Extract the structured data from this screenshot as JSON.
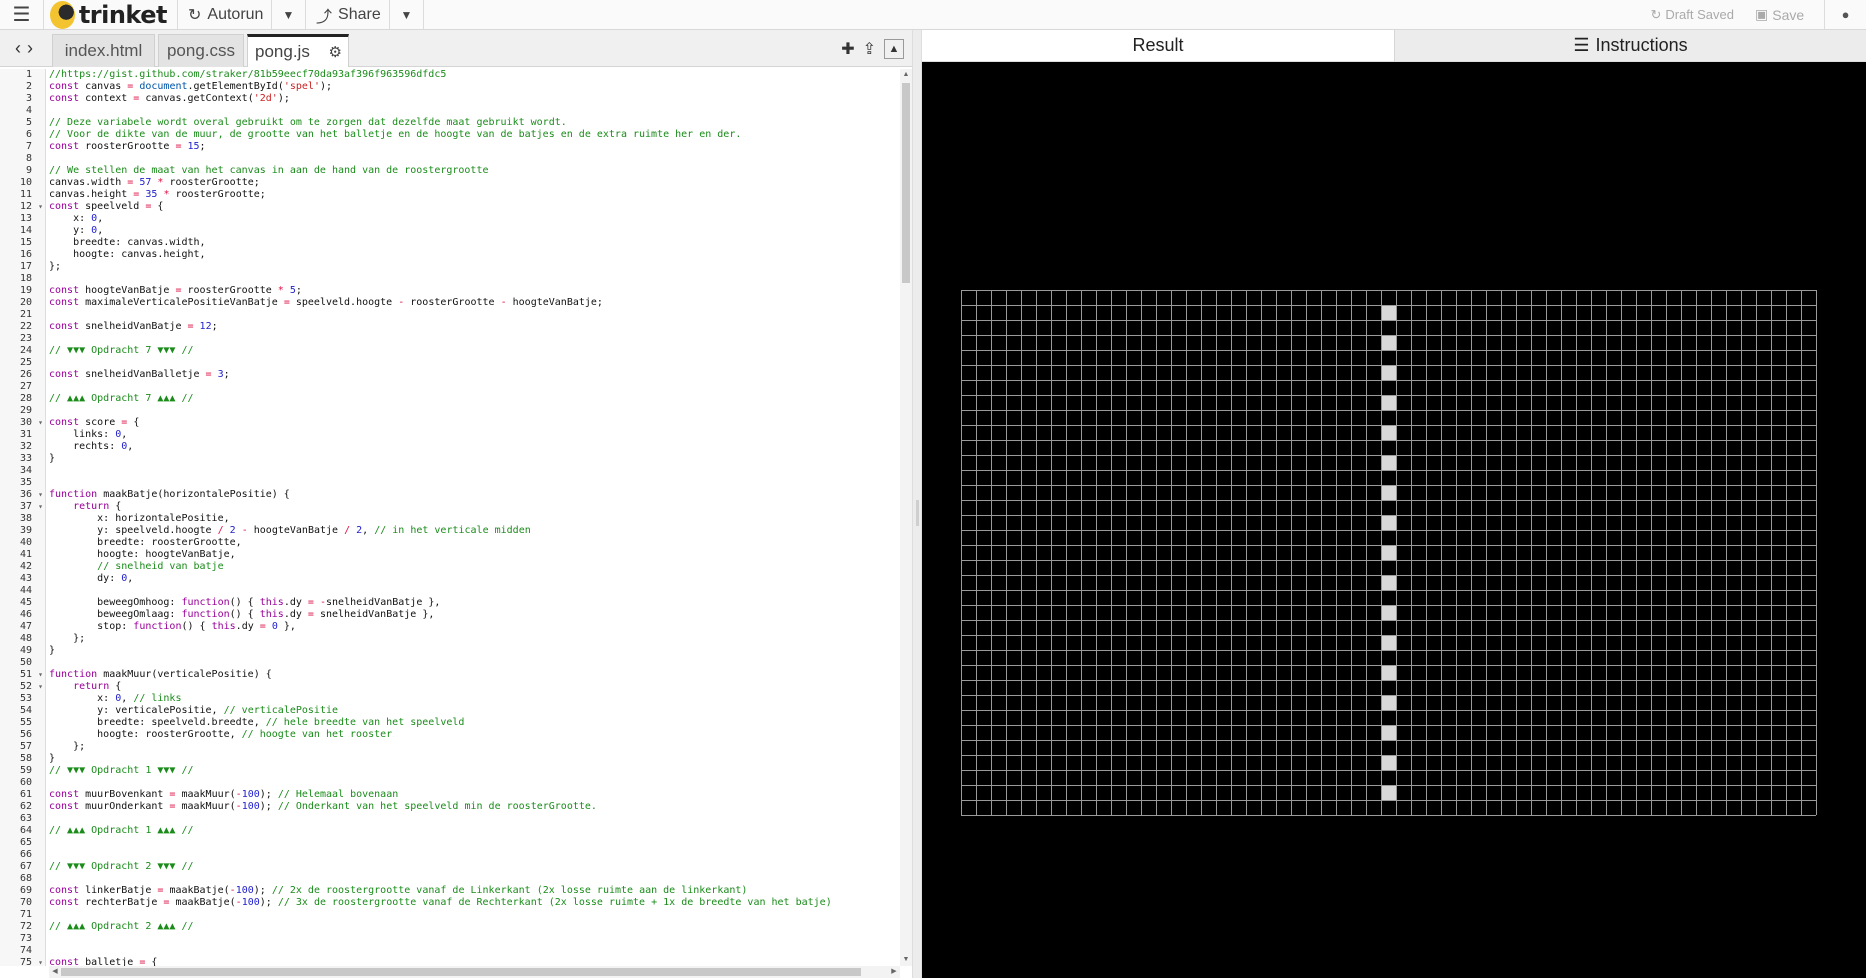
{
  "topbar": {
    "brand": "trinket",
    "autorun_label": "Autorun",
    "share_label": "Share",
    "draft_status": "Draft Saved",
    "save_label": "Save"
  },
  "editor": {
    "tabs": [
      {
        "label": "index.html",
        "active": false
      },
      {
        "label": "pong.css",
        "active": false
      },
      {
        "label": "pong.js",
        "active": true
      }
    ],
    "folds": [
      12,
      30,
      36,
      37,
      51,
      52,
      75
    ],
    "code": [
      "//https://gist.github.com/straker/81b59eecf70da93af396f963596dfdc5",
      "const canvas = document.getElementById('spel');",
      "const context = canvas.getContext('2d');",
      "",
      "// Deze variabele wordt overal gebruikt om te zorgen dat dezelfde maat gebruikt wordt.",
      "// Voor de dikte van de muur, de grootte van het balletje en de hoogte van de batjes en de extra ruimte her en der.",
      "const roosterGrootte = 15;",
      "",
      "// We stellen de maat van het canvas in aan de hand van de roostergrootte",
      "canvas.width = 57 * roosterGrootte;",
      "canvas.height = 35 * roosterGrootte;",
      "const speelveld = {",
      "    x: 0,",
      "    y: 0,",
      "    breedte: canvas.width,",
      "    hoogte: canvas.height,",
      "};",
      "",
      "const hoogteVanBatje = roosterGrootte * 5;",
      "const maximaleVerticalePositieVanBatje = speelveld.hoogte - roosterGrootte - hoogteVanBatje;",
      "",
      "const snelheidVanBatje = 12;",
      "",
      "// ▼▼▼ Opdracht 7 ▼▼▼ //",
      "",
      "const snelheidVanBalletje = 3;",
      "",
      "// ▲▲▲ Opdracht 7 ▲▲▲ //",
      "",
      "const score = {",
      "    links: 0,",
      "    rechts: 0,",
      "}",
      "",
      "",
      "function maakBatje(horizontalePositie) {",
      "    return {",
      "        x: horizontalePositie,",
      "        y: speelveld.hoogte / 2 - hoogteVanBatje / 2, // in het verticale midden",
      "        breedte: roosterGrootte,",
      "        hoogte: hoogteVanBatje,",
      "        // snelheid van batje",
      "        dy: 0,",
      "",
      "        beweegOmhoog: function() { this.dy = -snelheidVanBatje },",
      "        beweegOmlaag: function() { this.dy = snelheidVanBatje },",
      "        stop: function() { this.dy = 0 },",
      "    };",
      "}",
      "",
      "function maakMuur(verticalePositie) {",
      "    return {",
      "        x: 0, // links",
      "        y: verticalePositie, // verticalePositie",
      "        breedte: speelveld.breedte, // hele breedte van het speelveld",
      "        hoogte: roosterGrootte, // hoogte van het rooster",
      "    };",
      "}",
      "// ▼▼▼ Opdracht 1 ▼▼▼ //",
      "",
      "const muurBovenkant = maakMuur(-100); // Helemaal bovenaan",
      "const muurOnderkant = maakMuur(-100); // Onderkant van het speelveld min de roosterGrootte.",
      "",
      "// ▲▲▲ Opdracht 1 ▲▲▲ //",
      "",
      "",
      "// ▼▼▼ Opdracht 2 ▼▼▼ //",
      "",
      "const linkerBatje = maakBatje(-100); // 2x de roostergrootte vanaf de Linkerkant (2x losse ruimte aan de linkerkant)",
      "const rechterBatje = maakBatje(-100); // 3x de roostergrootte vanaf de Rechterkant (2x losse ruimte + 1x de breedte van het batje)",
      "",
      "// ▲▲▲ Opdracht 2 ▲▲▲ //",
      "",
      "",
      "const balletje = {",
      ""
    ]
  },
  "output": {
    "result_tab": "Result",
    "instructions_tab": "Instructions",
    "game": {
      "cols": 57,
      "rows": 35,
      "grid_color": "#9a9a9a",
      "net_color": "#d8d8d8",
      "background": "#000000"
    }
  },
  "colors": {
    "comment": "#1a8c1a",
    "string": "#cc2222",
    "number": "#2222cc",
    "keyword": "#990099",
    "operator": "#d14",
    "property": "#0055aa"
  }
}
